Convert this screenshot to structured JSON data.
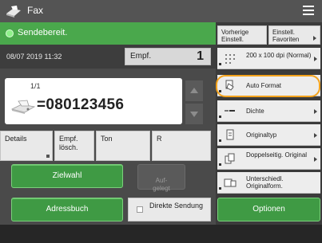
{
  "header": {
    "title": "Fax"
  },
  "status": {
    "text": "Sendebereit."
  },
  "info": {
    "datetime": "08/07 2019 11:32",
    "destinations_label": "Empf.",
    "destinations_count": "1"
  },
  "address": {
    "page": "1/1",
    "number": "=080123456"
  },
  "small_buttons": {
    "details": "Details",
    "delete": "Empf. lösch.",
    "tone": "Ton",
    "r": "R"
  },
  "left_buttons": {
    "speed_dial": "Zielwahl",
    "on_hook": "Auf-\ngelegt",
    "address_book": "Adressbuch",
    "direct_send": "Direkte Sendung"
  },
  "right_top": {
    "previous": "Vorherige Einstell.",
    "favorites": "Einstell. Favoriten"
  },
  "settings": [
    {
      "icon": "resolution-icon",
      "label": "200 x 100 dpi (Normal)"
    },
    {
      "icon": "auto-format-icon",
      "label": "Auto Format"
    },
    {
      "icon": "density-icon",
      "label": "Dichte"
    },
    {
      "icon": "original-type-icon",
      "label": "Originaltyp"
    },
    {
      "icon": "two-sided-icon",
      "label": "Doppelseitig. Original"
    },
    {
      "icon": "different-size-icon",
      "label": "Unterschiedl. Originalform."
    }
  ],
  "options": {
    "label": "Optionen"
  },
  "colors": {
    "accent_green": "#3f9a44",
    "highlight": "#f3a21b",
    "header": "#545454"
  }
}
